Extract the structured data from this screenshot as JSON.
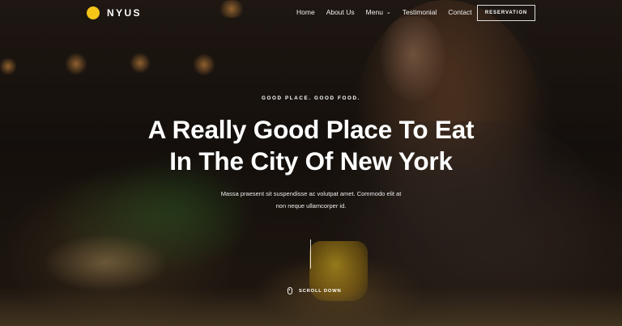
{
  "brand": {
    "name": "NYUS",
    "accent": "#f5c518"
  },
  "nav": {
    "items": [
      "Home",
      "About Us",
      "Menu",
      "Testimonial",
      "Contact"
    ],
    "menu_dropdown_icon": "chevron-down-icon",
    "reservation_label": "RESERVATION"
  },
  "hero": {
    "kicker": "GOOD PLACE. GOOD FOOD.",
    "headline_line1": "A Really Good Place To Eat",
    "headline_line2": "In The City Of New York",
    "sub_line1": "Massa praesent sit suspendisse ac volutpat amet. Commodo elit at",
    "sub_line2": "non neque ullamcorper id."
  },
  "scroll": {
    "label": "SCROLL DOWN",
    "icon": "mouse-icon"
  }
}
